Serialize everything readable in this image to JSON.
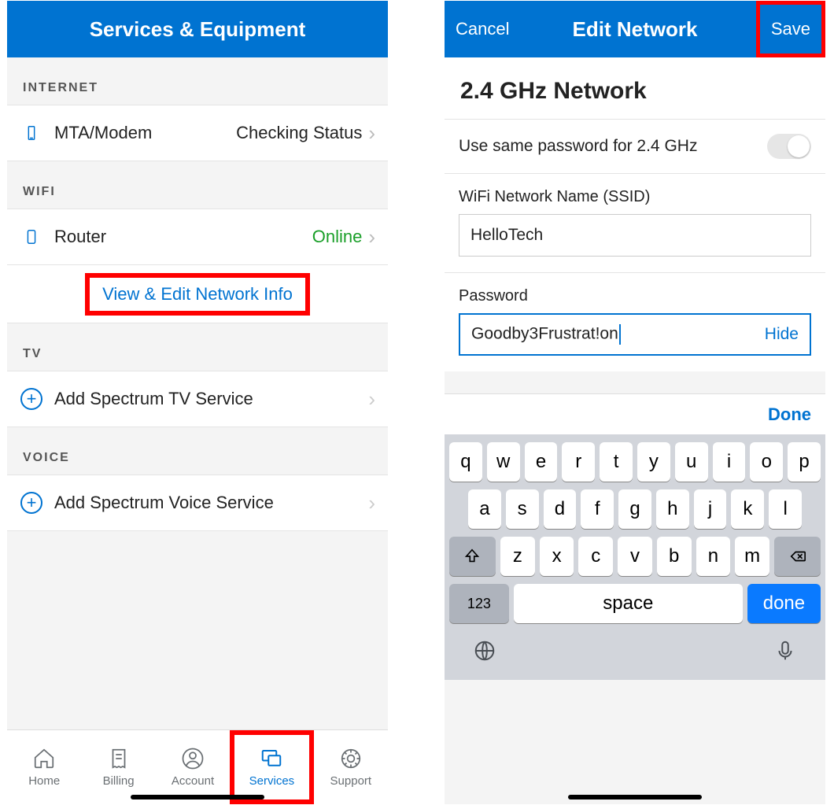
{
  "left": {
    "header": {
      "title": "Services & Equipment"
    },
    "sections": {
      "internet": {
        "label": "INTERNET",
        "item_label": "MTA/Modem",
        "item_status": "Checking Status"
      },
      "wifi": {
        "label": "WIFI",
        "item_label": "Router",
        "item_status": "Online",
        "link_label": "View & Edit Network Info"
      },
      "tv": {
        "label": "TV",
        "item_label": "Add Spectrum TV Service"
      },
      "voice": {
        "label": "VOICE",
        "item_label": "Add Spectrum Voice Service"
      }
    },
    "tabs": {
      "home": "Home",
      "billing": "Billing",
      "account": "Account",
      "services": "Services",
      "support": "Support"
    }
  },
  "right": {
    "header": {
      "cancel": "Cancel",
      "title": "Edit Network",
      "save": "Save"
    },
    "section_title": "2.4 GHz Network",
    "same_pw_label": "Use same password for 2.4 GHz",
    "ssid_label": "WiFi Network Name (SSID)",
    "ssid_value": "HelloTech",
    "pw_label": "Password",
    "pw_value": "Goodby3Frustrat!on",
    "hide_label": "Hide",
    "kb_done_top": "Done",
    "keys": {
      "r1": [
        "q",
        "w",
        "e",
        "r",
        "t",
        "y",
        "u",
        "i",
        "o",
        "p"
      ],
      "r2": [
        "a",
        "s",
        "d",
        "f",
        "g",
        "h",
        "j",
        "k",
        "l"
      ],
      "r3": [
        "z",
        "x",
        "c",
        "v",
        "b",
        "n",
        "m"
      ],
      "num": "123",
      "space": "space",
      "done": "done"
    }
  }
}
